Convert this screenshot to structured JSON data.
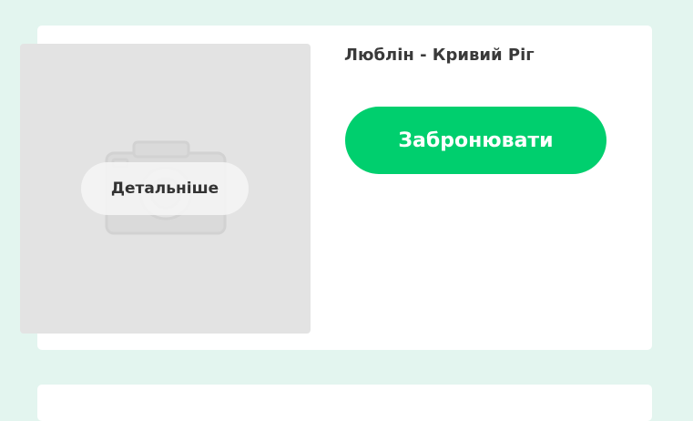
{
  "listing": {
    "route_title": "Люблін - Кривий Ріг",
    "details_label": "Детальніше",
    "book_label": "Забронювати",
    "photo_icon": "camera-icon"
  },
  "colors": {
    "page_background": "#e3f5ef",
    "card_background": "#ffffff",
    "photo_placeholder": "#e3e3e3",
    "book_button": "#00cf6e"
  }
}
